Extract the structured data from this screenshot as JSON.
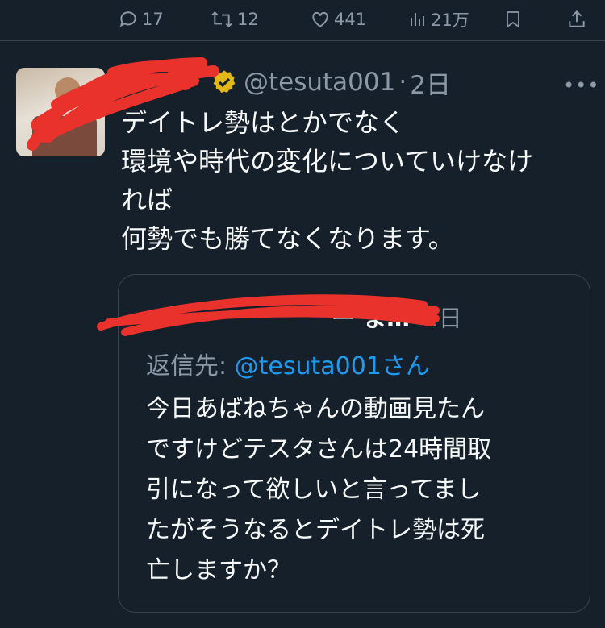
{
  "action_bar": {
    "reply_count": "17",
    "retweet_count": "12",
    "like_count": "441",
    "view_count": "21万",
    "icons": [
      "reply-icon",
      "retweet-icon",
      "heart-icon",
      "views-icon",
      "bookmark-icon",
      "share-icon"
    ]
  },
  "tweet": {
    "handle": "@tesuta001",
    "separator": "·",
    "time": "2日",
    "more": "•••",
    "lines": [
      "デイトレ勢はとかでなく",
      "環境や時代の変化についていけなけ",
      "れば",
      "何勢でも勝てなくなります。"
    ]
  },
  "quote": {
    "name_tail": "ー ま…",
    "separator": "·",
    "time": "2日",
    "reply_prefix": "返信先: ",
    "reply_mention": "@tesuta001さん",
    "lines": [
      "今日あばねちゃんの動画見たん",
      "ですけどテスタさんは24時間取",
      "引になって欲しいと言ってまし",
      "たがそうなるとデイトレ勢は死",
      "亡しますか？"
    ]
  },
  "colors": {
    "background": "#15202b",
    "text": "#f7f9f9",
    "muted": "#8b98a5",
    "link": "#1d9bf0",
    "verified": "#e2b719",
    "redaction": "#e8322b"
  }
}
